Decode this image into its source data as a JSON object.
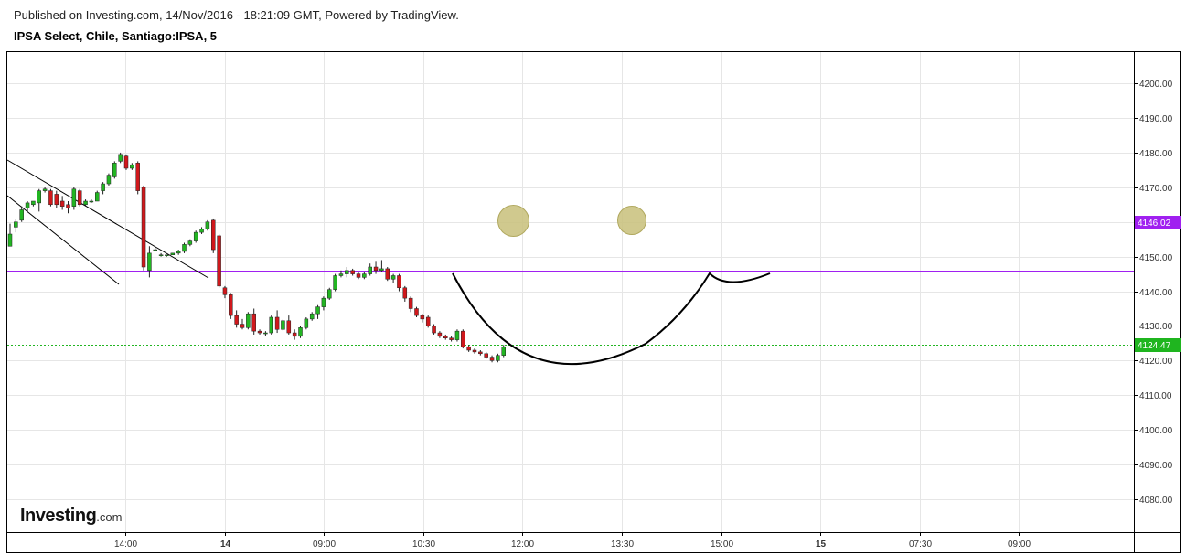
{
  "header": {
    "published": "Published on Investing.com, 14/Nov/2016 - 18:21:09 GMT, Powered by TradingView.",
    "symbol": "IPSA Select, Chile, Santiago:IPSA, 5"
  },
  "logo": {
    "main": "Investing",
    "suffix": ".com"
  },
  "colors": {
    "up": "#22b522",
    "down": "#d0181c",
    "purple_line": "#a020f0",
    "green_line": "#22b522",
    "grid": "#e6e6e6",
    "smiley": "#c8c07a"
  },
  "chart_data": {
    "type": "candlestick",
    "y_ticks": [
      "4200.00",
      "4190.00",
      "4180.00",
      "4170.00",
      "4160.00",
      "4150.00",
      "4140.00",
      "4130.00",
      "4120.00",
      "4110.00",
      "4100.00",
      "4090.00",
      "4080.00"
    ],
    "x_ticks": [
      {
        "label": "14:00",
        "bold": false
      },
      {
        "label": "14",
        "bold": true
      },
      {
        "label": "09:00",
        "bold": false
      },
      {
        "label": "10:30",
        "bold": false
      },
      {
        "label": "12:00",
        "bold": false
      },
      {
        "label": "13:30",
        "bold": false
      },
      {
        "label": "15:00",
        "bold": false
      },
      {
        "label": "15",
        "bold": true
      },
      {
        "label": "07:30",
        "bold": false
      },
      {
        "label": "09:00",
        "bold": false
      }
    ],
    "ylim": [
      4070.5,
      4209
    ],
    "price_labels": {
      "purple": {
        "value": 4146.02,
        "text": "4146.02"
      },
      "green": {
        "value": 4124.47,
        "text": "4124.47"
      }
    },
    "candles": [
      {
        "o": 4153.0,
        "h": 4159.5,
        "l": 4153.0,
        "c": 4156.5
      },
      {
        "o": 4158.5,
        "h": 4161.0,
        "l": 4157.0,
        "c": 4160.0
      },
      {
        "o": 4160.5,
        "h": 4164.5,
        "l": 4160.0,
        "c": 4163.5
      },
      {
        "o": 4164.0,
        "h": 4166.0,
        "l": 4163.0,
        "c": 4165.5
      },
      {
        "o": 4165.0,
        "h": 4166.0,
        "l": 4164.5,
        "c": 4166.0
      },
      {
        "o": 4165.5,
        "h": 4169.5,
        "l": 4163.0,
        "c": 4169.0
      },
      {
        "o": 4169.0,
        "h": 4170.0,
        "l": 4168.5,
        "c": 4169.5
      },
      {
        "o": 4169.0,
        "h": 4169.5,
        "l": 4164.5,
        "c": 4165.0
      },
      {
        "o": 4168.0,
        "h": 4169.0,
        "l": 4164.0,
        "c": 4165.0
      },
      {
        "o": 4166.0,
        "h": 4167.5,
        "l": 4163.5,
        "c": 4164.5
      },
      {
        "o": 4165.0,
        "h": 4166.0,
        "l": 4162.5,
        "c": 4164.0
      },
      {
        "o": 4164.5,
        "h": 4170.0,
        "l": 4163.5,
        "c": 4169.5
      },
      {
        "o": 4169.0,
        "h": 4169.5,
        "l": 4164.5,
        "c": 4165.0
      },
      {
        "o": 4165.0,
        "h": 4166.5,
        "l": 4164.5,
        "c": 4166.0
      },
      {
        "o": 4166.0,
        "h": 4166.5,
        "l": 4165.5,
        "c": 4166.0
      },
      {
        "o": 4166.0,
        "h": 4169.0,
        "l": 4166.0,
        "c": 4168.5
      },
      {
        "o": 4169.0,
        "h": 4171.5,
        "l": 4168.0,
        "c": 4171.0
      },
      {
        "o": 4171.0,
        "h": 4174.0,
        "l": 4170.5,
        "c": 4173.5
      },
      {
        "o": 4173.0,
        "h": 4177.5,
        "l": 4172.5,
        "c": 4177.0
      },
      {
        "o": 4177.5,
        "h": 4180.0,
        "l": 4177.0,
        "c": 4179.5
      },
      {
        "o": 4179.0,
        "h": 4179.5,
        "l": 4175.0,
        "c": 4175.5
      },
      {
        "o": 4175.5,
        "h": 4177.0,
        "l": 4175.0,
        "c": 4176.5
      },
      {
        "o": 4177.0,
        "h": 4177.5,
        "l": 4168.0,
        "c": 4169.0
      },
      {
        "o": 4170.0,
        "h": 4170.5,
        "l": 4146.0,
        "c": 4147.0
      },
      {
        "o": 4146.0,
        "h": 4153.0,
        "l": 4144.0,
        "c": 4151.0
      },
      {
        "o": 4152.0,
        "h": 4152.5,
        "l": 4151.5,
        "c": 4152.0
      },
      {
        "o": 4150.5,
        "h": 4151.0,
        "l": 4150.0,
        "c": 4150.5
      },
      {
        "o": 4150.5,
        "h": 4150.5,
        "l": 4150.0,
        "c": 4150.5
      },
      {
        "o": 4150.5,
        "h": 4151.0,
        "l": 4150.5,
        "c": 4151.0
      },
      {
        "o": 4151.0,
        "h": 4152.0,
        "l": 4150.5,
        "c": 4151.5
      },
      {
        "o": 4151.5,
        "h": 4154.0,
        "l": 4151.0,
        "c": 4153.5
      },
      {
        "o": 4153.5,
        "h": 4155.0,
        "l": 4153.0,
        "c": 4154.5
      },
      {
        "o": 4154.5,
        "h": 4157.5,
        "l": 4154.0,
        "c": 4157.0
      },
      {
        "o": 4157.0,
        "h": 4158.5,
        "l": 4156.5,
        "c": 4158.0
      },
      {
        "o": 4158.0,
        "h": 4160.5,
        "l": 4157.5,
        "c": 4160.0
      },
      {
        "o": 4160.5,
        "h": 4161.0,
        "l": 4151.0,
        "c": 4152.0
      },
      {
        "o": 4156.0,
        "h": 4156.5,
        "l": 4141.0,
        "c": 4141.5
      },
      {
        "o": 4141.0,
        "h": 4141.5,
        "l": 4138.0,
        "c": 4139.0
      },
      {
        "o": 4139.0,
        "h": 4139.5,
        "l": 4132.0,
        "c": 4133.0
      },
      {
        "o": 4133.0,
        "h": 4134.5,
        "l": 4129.5,
        "c": 4130.5
      },
      {
        "o": 4130.5,
        "h": 4132.0,
        "l": 4129.0,
        "c": 4129.5
      },
      {
        "o": 4129.5,
        "h": 4134.0,
        "l": 4129.0,
        "c": 4133.5
      },
      {
        "o": 4133.5,
        "h": 4135.0,
        "l": 4127.5,
        "c": 4128.5
      },
      {
        "o": 4128.5,
        "h": 4129.0,
        "l": 4127.5,
        "c": 4128.0
      },
      {
        "o": 4128.0,
        "h": 4128.5,
        "l": 4127.0,
        "c": 4128.0
      },
      {
        "o": 4128.0,
        "h": 4133.0,
        "l": 4127.5,
        "c": 4132.5
      },
      {
        "o": 4132.5,
        "h": 4134.5,
        "l": 4128.0,
        "c": 4129.0
      },
      {
        "o": 4129.0,
        "h": 4132.0,
        "l": 4128.5,
        "c": 4131.5
      },
      {
        "o": 4131.5,
        "h": 4133.0,
        "l": 4127.5,
        "c": 4128.0
      },
      {
        "o": 4128.0,
        "h": 4129.0,
        "l": 4126.0,
        "c": 4127.0
      },
      {
        "o": 4127.0,
        "h": 4130.0,
        "l": 4126.5,
        "c": 4129.5
      },
      {
        "o": 4129.5,
        "h": 4132.5,
        "l": 4129.0,
        "c": 4132.0
      },
      {
        "o": 4132.0,
        "h": 4134.0,
        "l": 4131.5,
        "c": 4133.5
      },
      {
        "o": 4133.5,
        "h": 4136.0,
        "l": 4132.0,
        "c": 4135.5
      },
      {
        "o": 4135.5,
        "h": 4138.5,
        "l": 4134.5,
        "c": 4138.0
      },
      {
        "o": 4138.0,
        "h": 4141.0,
        "l": 4137.5,
        "c": 4140.5
      },
      {
        "o": 4140.5,
        "h": 4145.0,
        "l": 4140.0,
        "c": 4144.5
      },
      {
        "o": 4144.5,
        "h": 4146.0,
        "l": 4144.0,
        "c": 4145.0
      },
      {
        "o": 4145.0,
        "h": 4147.0,
        "l": 4144.0,
        "c": 4146.0
      },
      {
        "o": 4146.0,
        "h": 4146.5,
        "l": 4144.5,
        "c": 4145.0
      },
      {
        "o": 4145.0,
        "h": 4145.5,
        "l": 4143.5,
        "c": 4144.0
      },
      {
        "o": 4144.0,
        "h": 4145.5,
        "l": 4143.5,
        "c": 4145.0
      },
      {
        "o": 4145.0,
        "h": 4148.0,
        "l": 4144.5,
        "c": 4147.0
      },
      {
        "o": 4147.0,
        "h": 4148.5,
        "l": 4145.0,
        "c": 4146.0
      },
      {
        "o": 4146.0,
        "h": 4149.0,
        "l": 4145.5,
        "c": 4146.5
      },
      {
        "o": 4146.5,
        "h": 4147.0,
        "l": 4143.0,
        "c": 4143.5
      },
      {
        "o": 4143.5,
        "h": 4145.0,
        "l": 4142.5,
        "c": 4144.5
      },
      {
        "o": 4144.5,
        "h": 4145.0,
        "l": 4140.0,
        "c": 4141.0
      },
      {
        "o": 4141.0,
        "h": 4141.5,
        "l": 4137.0,
        "c": 4138.0
      },
      {
        "o": 4138.0,
        "h": 4138.5,
        "l": 4134.0,
        "c": 4135.0
      },
      {
        "o": 4135.0,
        "h": 4135.5,
        "l": 4132.5,
        "c": 4133.0
      },
      {
        "o": 4133.0,
        "h": 4133.5,
        "l": 4131.0,
        "c": 4132.0
      },
      {
        "o": 4132.5,
        "h": 4133.0,
        "l": 4129.5,
        "c": 4130.0
      },
      {
        "o": 4130.0,
        "h": 4130.5,
        "l": 4127.5,
        "c": 4128.0
      },
      {
        "o": 4128.0,
        "h": 4128.5,
        "l": 4126.5,
        "c": 4127.0
      },
      {
        "o": 4127.0,
        "h": 4127.5,
        "l": 4126.0,
        "c": 4126.5
      },
      {
        "o": 4126.5,
        "h": 4127.0,
        "l": 4125.5,
        "c": 4126.0
      },
      {
        "o": 4126.0,
        "h": 4129.0,
        "l": 4125.5,
        "c": 4128.5
      },
      {
        "o": 4128.5,
        "h": 4129.0,
        "l": 4123.5,
        "c": 4124.0
      },
      {
        "o": 4124.0,
        "h": 4124.5,
        "l": 4122.5,
        "c": 4123.0
      },
      {
        "o": 4123.0,
        "h": 4123.5,
        "l": 4122.0,
        "c": 4122.5
      },
      {
        "o": 4122.5,
        "h": 4123.0,
        "l": 4121.5,
        "c": 4122.0
      },
      {
        "o": 4122.0,
        "h": 4122.5,
        "l": 4120.5,
        "c": 4121.0
      },
      {
        "o": 4121.0,
        "h": 4121.5,
        "l": 4119.5,
        "c": 4120.0
      },
      {
        "o": 4120.0,
        "h": 4122.0,
        "l": 4119.5,
        "c": 4121.5
      },
      {
        "o": 4121.5,
        "h": 4124.5,
        "l": 4121.0,
        "c": 4124.0
      }
    ]
  }
}
